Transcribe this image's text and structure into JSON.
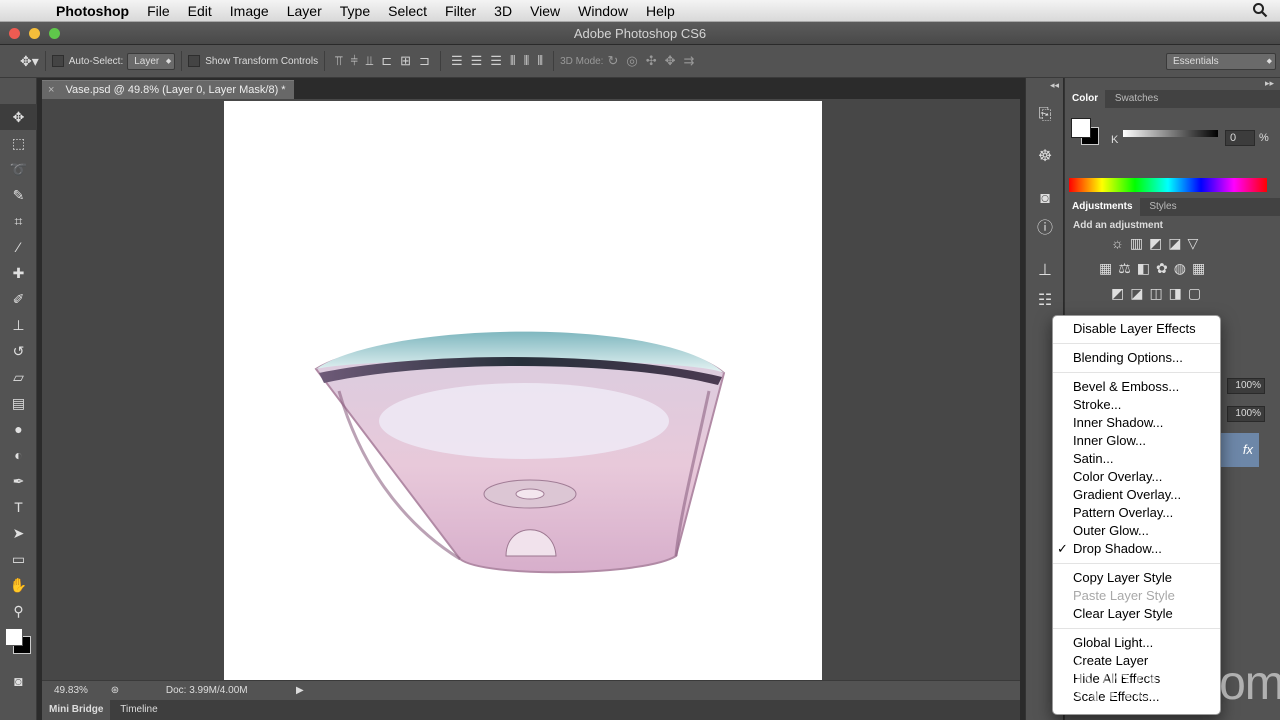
{
  "menubar": {
    "app": "Photoshop",
    "items": [
      "File",
      "Edit",
      "Image",
      "Layer",
      "Type",
      "Select",
      "Filter",
      "3D",
      "View",
      "Window",
      "Help"
    ]
  },
  "window": {
    "title": "Adobe Photoshop CS6"
  },
  "options": {
    "auto_select_label": "Auto-Select:",
    "auto_select_value": "Layer",
    "transform_label": "Show Transform Controls",
    "mode3d": "3D Mode:",
    "workspace": "Essentials"
  },
  "document": {
    "tab": "Vase.psd @ 49.8% (Layer 0, Layer Mask/8) *",
    "zoom": "49.83%",
    "doc_info": "Doc: 3.99M/4.00M"
  },
  "bottom_tabs": [
    "Mini Bridge",
    "Timeline"
  ],
  "color_panel": {
    "tabs": [
      "Color",
      "Swatches"
    ],
    "channel": "K",
    "value": "0",
    "unit": "%"
  },
  "adjust_panel": {
    "tabs": [
      "Adjustments",
      "Styles"
    ],
    "heading": "Add an adjustment"
  },
  "layers": {
    "opacity": "100%",
    "fill": "100%",
    "fx": "fx"
  },
  "context_menu": {
    "groups": [
      [
        {
          "label": "Disable Layer Effects"
        }
      ],
      [
        {
          "label": "Blending Options..."
        }
      ],
      [
        {
          "label": "Bevel & Emboss..."
        },
        {
          "label": "Stroke..."
        },
        {
          "label": "Inner Shadow..."
        },
        {
          "label": "Inner Glow..."
        },
        {
          "label": "Satin..."
        },
        {
          "label": "Color Overlay..."
        },
        {
          "label": "Gradient Overlay..."
        },
        {
          "label": "Pattern Overlay..."
        },
        {
          "label": "Outer Glow..."
        },
        {
          "label": "Drop Shadow...",
          "checked": true
        }
      ],
      [
        {
          "label": "Copy Layer Style"
        },
        {
          "label": "Paste Layer Style",
          "disabled": true
        },
        {
          "label": "Clear Layer Style"
        }
      ],
      [
        {
          "label": "Global Light..."
        },
        {
          "label": "Create Layer"
        },
        {
          "label": "Hide All Effects"
        },
        {
          "label": "Scale Effects..."
        }
      ]
    ]
  },
  "watermark": "lynda.com"
}
